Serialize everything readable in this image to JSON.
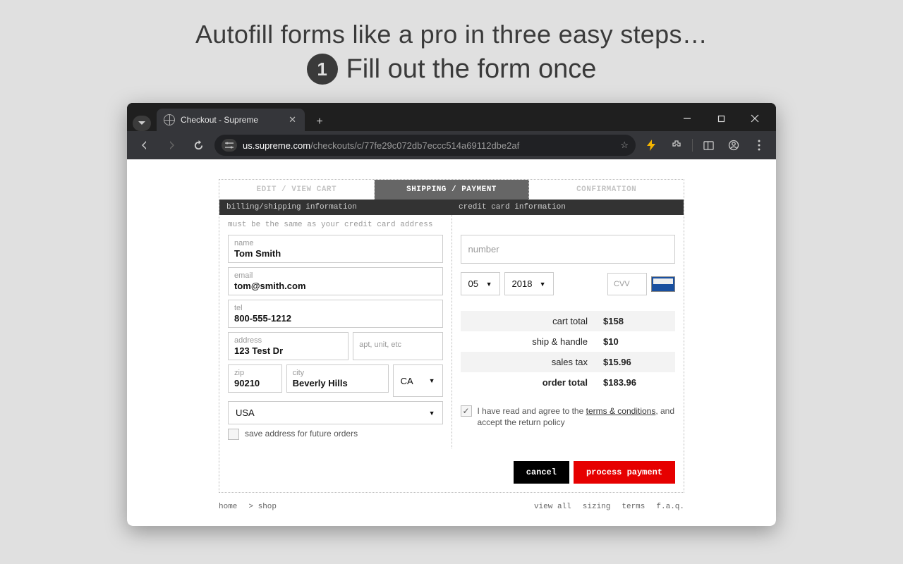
{
  "promo": {
    "title": "Autofill forms like a pro in three easy steps…",
    "step_number": "1",
    "step_text": "Fill out the form once"
  },
  "browser": {
    "tab_title": "Checkout - Supreme",
    "url_host": "us.supreme.com",
    "url_path": "/checkouts/c/77fe29c072db7eccc514a69112dbe2af"
  },
  "checkout": {
    "tabs": {
      "edit_cart": "EDIT / VIEW CART",
      "shipping_payment": "SHIPPING / PAYMENT",
      "confirmation": "CONFIRMATION"
    },
    "section_headers": {
      "billing": "billing/shipping information",
      "credit": "credit card information"
    },
    "note": "must be the same as your credit card address",
    "fields": {
      "name_label": "name",
      "name_value": "Tom Smith",
      "email_label": "email",
      "email_value": "tom@smith.com",
      "tel_label": "tel",
      "tel_value": "800-555-1212",
      "address_label": "address",
      "address_value": "123 Test Dr",
      "apt_placeholder": "apt, unit, etc",
      "zip_label": "zip",
      "zip_value": "90210",
      "city_label": "city",
      "city_value": "Beverly Hills",
      "state_value": "CA",
      "country_value": "USA",
      "save_address_label": "save address for future orders"
    },
    "credit": {
      "number_placeholder": "number",
      "month": "05",
      "year": "2018",
      "cvv_placeholder": "CVV"
    },
    "totals": {
      "cart_label": "cart total",
      "cart_value": "$158",
      "ship_label": "ship & handle",
      "ship_value": "$10",
      "tax_label": "sales tax",
      "tax_value": "$15.96",
      "order_label": "order total",
      "order_value": "$183.96"
    },
    "terms": {
      "prefix": "I have read and agree to the ",
      "link": "terms & conditions",
      "suffix": ", and accept the return policy"
    },
    "buttons": {
      "cancel": "cancel",
      "process": "process payment"
    },
    "footer": {
      "home": "home",
      "shop": "> shop",
      "view_all": "view all",
      "sizing": "sizing",
      "terms": "terms",
      "faq": "f.a.q."
    }
  }
}
